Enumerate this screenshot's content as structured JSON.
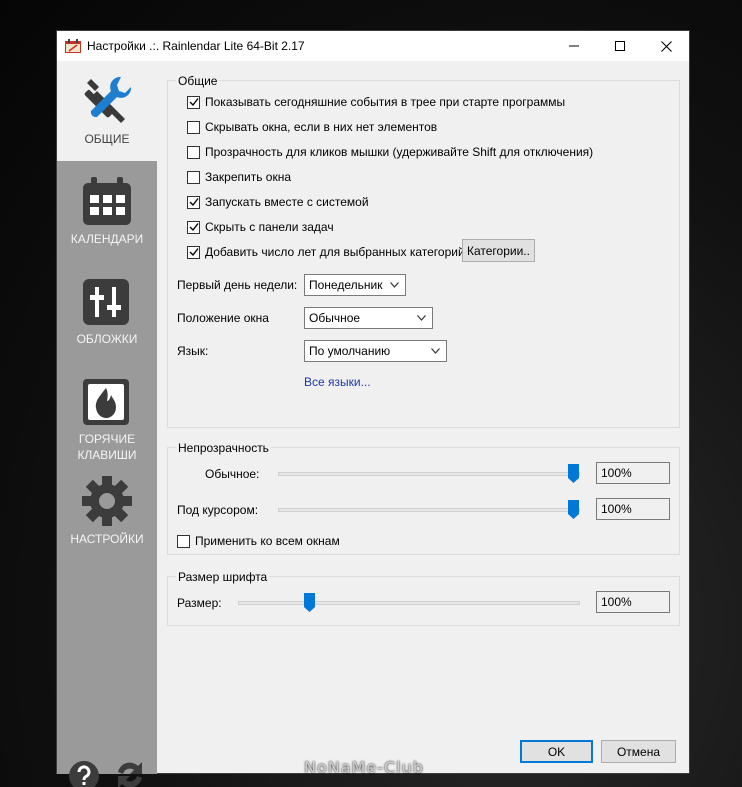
{
  "window": {
    "title": "Настройки .:. Rainlendar Lite 64-Bit 2.17",
    "controls": {
      "minimize": "minimize-icon",
      "maximize": "maximize-icon",
      "close": "close-icon"
    }
  },
  "sidebar": {
    "items": [
      {
        "label": "ОБЩИЕ",
        "icon": "tools-icon",
        "active": true
      },
      {
        "label": "КАЛЕНДАРИ",
        "icon": "calendar-icon",
        "active": false
      },
      {
        "label": "ОБЛОЖКИ",
        "icon": "sliders-icon",
        "active": false
      },
      {
        "label_line1": "ГОРЯЧИЕ",
        "label_line2": "КЛАВИШИ",
        "icon": "flame-icon",
        "active": false
      },
      {
        "label": "НАСТРОЙКИ",
        "icon": "gear-icon",
        "active": false
      }
    ],
    "bottom_icons": [
      "help-icon",
      "sync-icon"
    ]
  },
  "general": {
    "title": "Общие",
    "checkboxes": [
      {
        "label": "Показывать сегодняшние события в трее при старте программы",
        "checked": true
      },
      {
        "label": "Скрывать окна, если в них нет элементов",
        "checked": false
      },
      {
        "label": "Прозрачность для кликов мышки (удерживайте Shift для отключения)",
        "checked": false
      },
      {
        "label": "Закрепить окна",
        "checked": false
      },
      {
        "label": "Запускать вместе с системой",
        "checked": true
      },
      {
        "label": "Скрыть с панели задач",
        "checked": true
      },
      {
        "label": "Добавить число лет для выбранных категорий",
        "checked": true
      }
    ],
    "categories_button": "Категории..",
    "first_day_label": "Первый день недели:",
    "first_day_value": "Понедельник",
    "window_position_label": "Положение окна",
    "window_position_value": "Обычное",
    "language_label": "Язык:",
    "language_value": "По умолчанию",
    "all_languages_link": "Все языки..."
  },
  "opacity": {
    "title": "Непрозрачность",
    "normal_label": "Обычное:",
    "normal_value": "100%",
    "normal_level": 1.0,
    "hover_label": "Под курсором:",
    "hover_value": "100%",
    "hover_level": 1.0,
    "apply_all_label": "Применить ко всем окнам",
    "apply_all_checked": false
  },
  "font_size": {
    "title": "Размер шрифта",
    "size_label": "Размер:",
    "size_value": "100%"
  },
  "footer": {
    "ok": "OK",
    "cancel": "Отмена"
  },
  "watermark": "NoNaMe-Club",
  "colors": {
    "accent": "#0078d7",
    "sidebar": "#9a9a9a",
    "icon_blue": "#1e7fd0",
    "icon_dark": "#3a3a3a"
  }
}
